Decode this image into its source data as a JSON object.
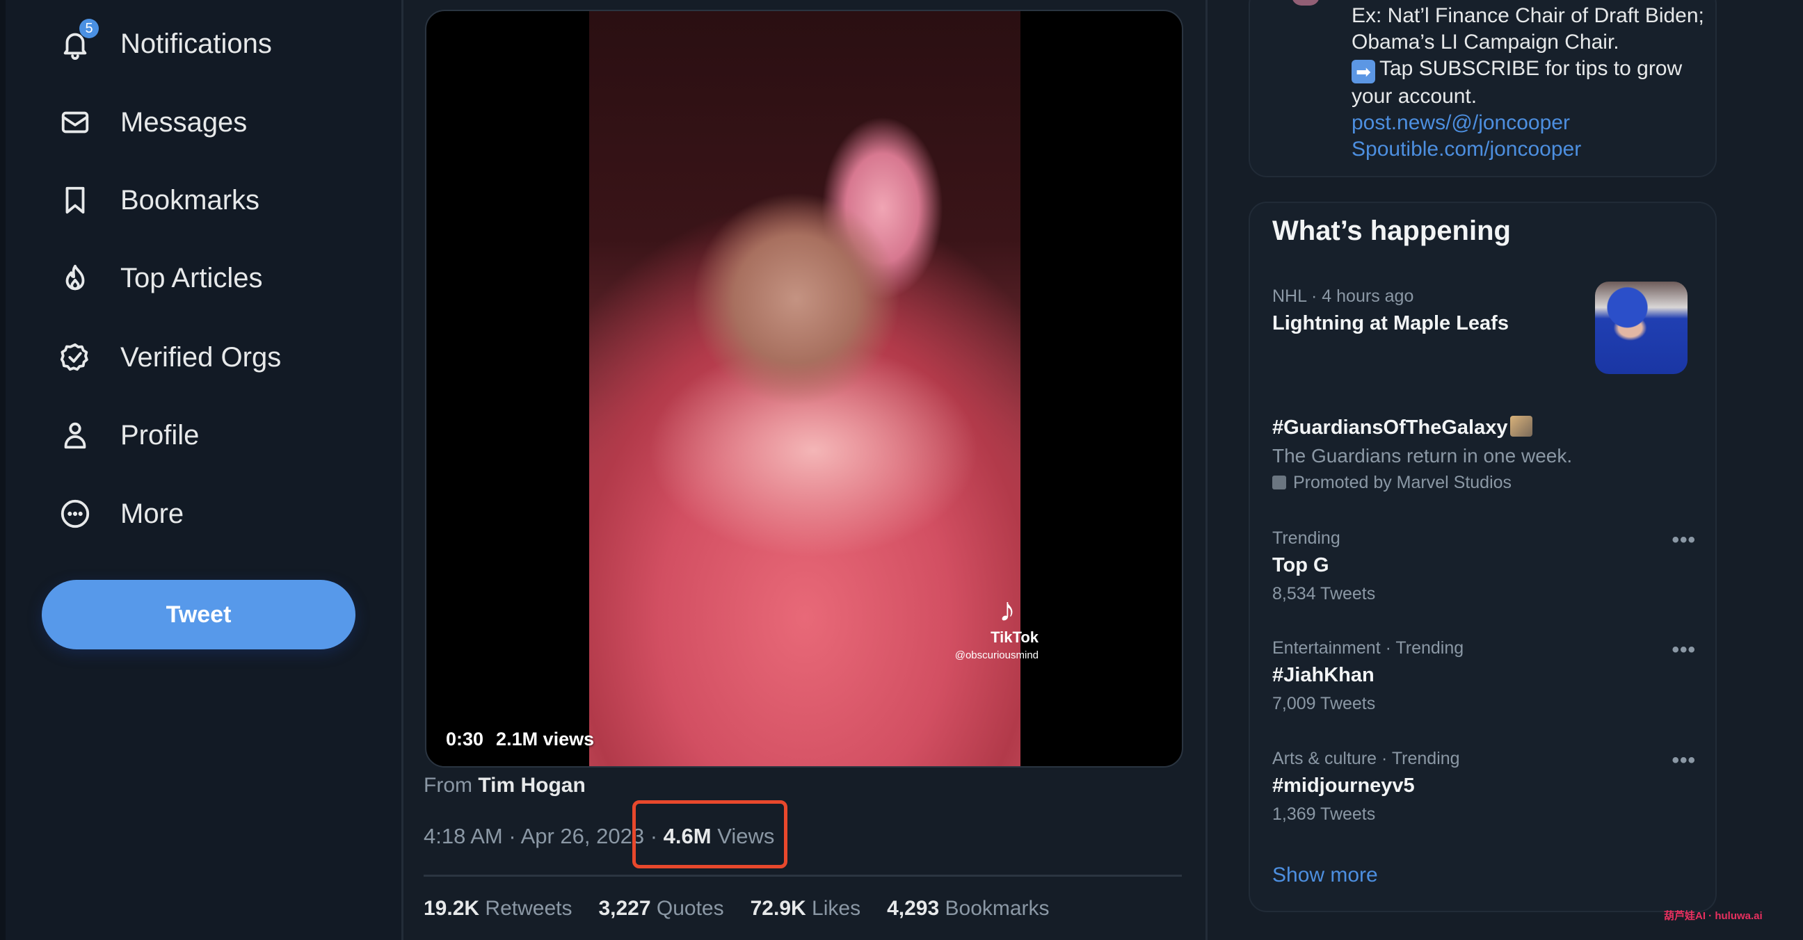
{
  "sidebar": {
    "items": [
      {
        "label": "Notifications",
        "icon": "bell-icon",
        "badge": "5"
      },
      {
        "label": "Messages",
        "icon": "envelope-icon"
      },
      {
        "label": "Bookmarks",
        "icon": "bookmark-icon"
      },
      {
        "label": "Top Articles",
        "icon": "flame-icon"
      },
      {
        "label": "Verified Orgs",
        "icon": "verified-badge-icon"
      },
      {
        "label": "Profile",
        "icon": "person-icon"
      },
      {
        "label": "More",
        "icon": "more-circle-icon"
      }
    ],
    "tweet_button": "Tweet"
  },
  "tweet": {
    "video": {
      "duration": "0:30",
      "views": "2.1M views",
      "watermark_brand": "TikTok",
      "watermark_handle": "@obscuriousmind"
    },
    "from_prefix": "From",
    "from_name": "Tim Hogan",
    "timestamp": "4:18 AM · Apr 26, 2023 · ",
    "views_count": "4.6M",
    "views_label": "Views",
    "stats": [
      {
        "value": "19.2K",
        "label": "Retweets"
      },
      {
        "value": "3,227",
        "label": "Quotes"
      },
      {
        "value": "72.9K",
        "label": "Likes"
      },
      {
        "value": "4,293",
        "label": "Bookmarks"
      }
    ],
    "highlight_color": "#e8482c"
  },
  "right": {
    "bio": {
      "line1": "Ex: Nat’l Finance Chair of Draft Biden; Obama’s LI Campaign Chair.",
      "arrow_emoji": "➡",
      "line2": "Tap SUBSCRIBE for tips to grow your account.",
      "links": [
        "post.news/@/joncooper",
        "Spoutible.com/joncooper"
      ]
    },
    "whats_happening": {
      "title": "What’s happening",
      "trends": [
        {
          "meta": "NHL · 4 hours ago",
          "name": "Lightning at Maple Leafs",
          "has_image": true
        },
        {
          "name": "#GuardiansOfTheGalaxy",
          "subtitle": "The Guardians return in one week.",
          "promoted": "Promoted by Marvel Studios"
        },
        {
          "meta": "Trending",
          "name": "Top G",
          "count": "8,534 Tweets"
        },
        {
          "meta": "Entertainment · Trending",
          "name": "#JiahKhan",
          "count": "7,009 Tweets"
        },
        {
          "meta": "Arts & culture · Trending",
          "name": "#midjourneyv5",
          "count": "1,369 Tweets"
        }
      ],
      "more_icon": "•••",
      "show_more": "Show more"
    }
  },
  "watermark": "葫芦娃AI · huluwa.ai",
  "colors": {
    "accent": "#5799ea",
    "link": "#4d8fe0",
    "background": "#151d27"
  }
}
